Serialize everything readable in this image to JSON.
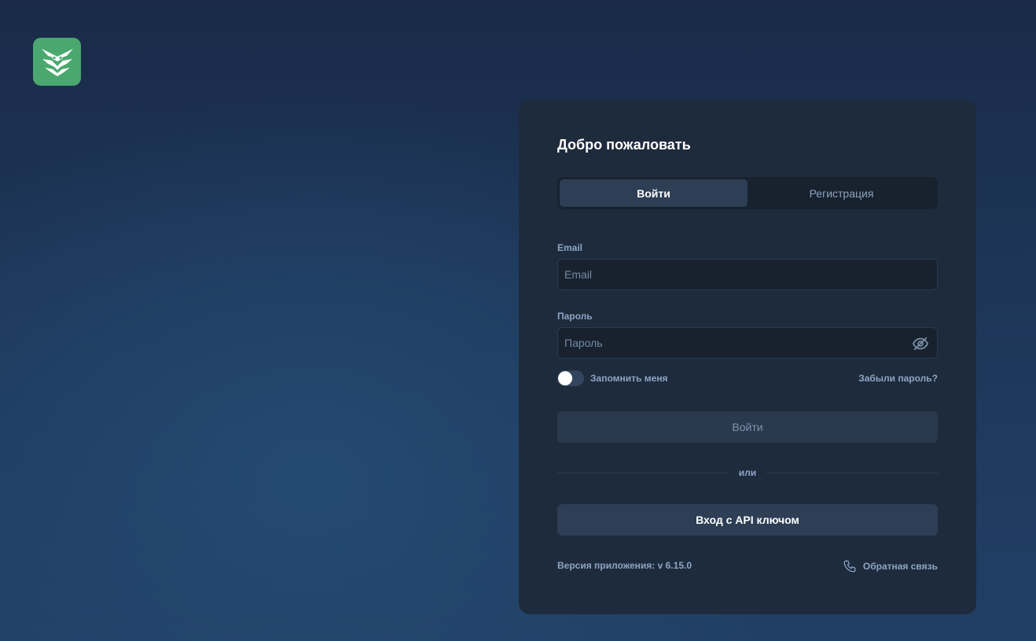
{
  "brand": {
    "logo_icon": "owl-logo-icon",
    "logo_color": "#4aa86f"
  },
  "card": {
    "title": "Добро пожаловать",
    "tabs": [
      {
        "label": "Войти",
        "active": true
      },
      {
        "label": "Регистрация",
        "active": false
      }
    ],
    "email": {
      "label": "Email",
      "placeholder": "Email",
      "value": ""
    },
    "password": {
      "label": "Пароль",
      "placeholder": "Пароль",
      "value": "",
      "visibility_icon": "eye-off-icon"
    },
    "remember": {
      "label": "Запомнить меня",
      "checked": false
    },
    "forgot_label": "Забыли пароль?",
    "login_button": "Войти",
    "divider_text": "или",
    "api_button": "Вход с API ключом",
    "version": "Версия приложения: v 6.15.0",
    "feedback": {
      "label": "Обратная связь",
      "icon": "phone-icon"
    }
  }
}
